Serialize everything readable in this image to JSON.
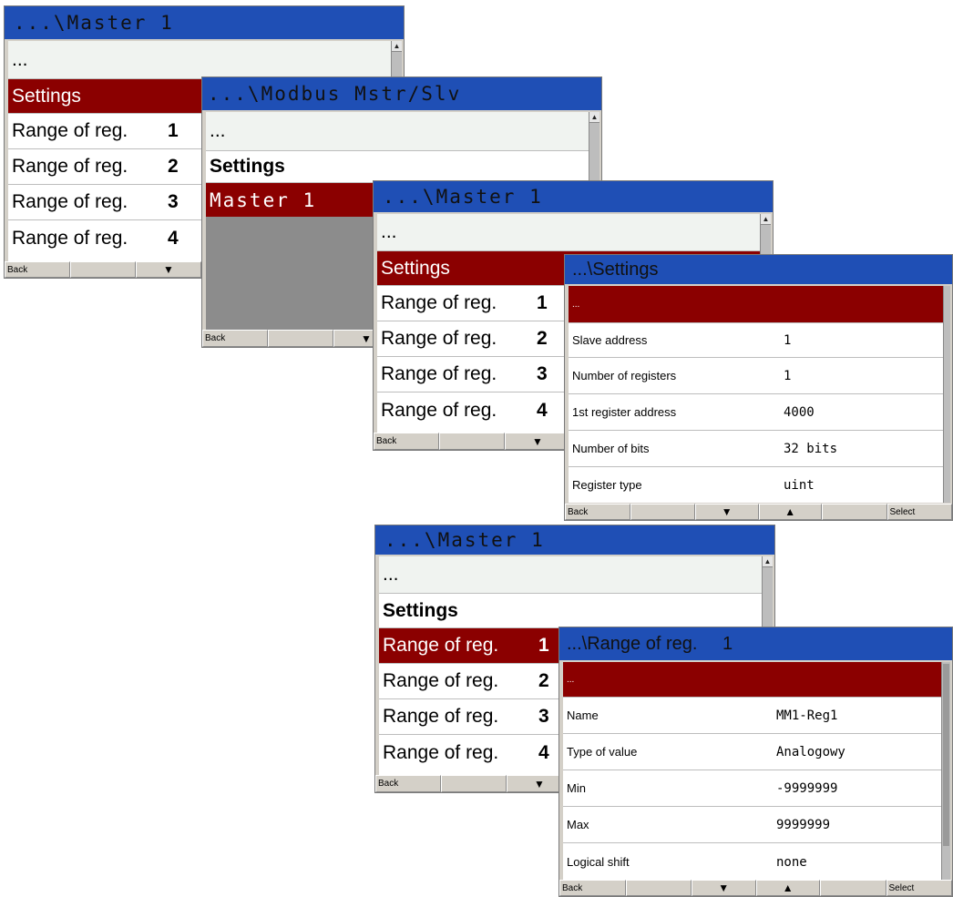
{
  "colors": {
    "title_bar": "#1f4fb5",
    "selected_row": "#8b0000",
    "footer": "#d4d0c8"
  },
  "screen1": {
    "title": "...\\Master  1",
    "rows": [
      {
        "label": "..."
      },
      {
        "label": "Settings"
      },
      {
        "label": "Range of reg.",
        "number": "1"
      },
      {
        "label": "Range of reg.",
        "number": "2"
      },
      {
        "label": "Range of reg.",
        "number": "3"
      },
      {
        "label": "Range of reg.",
        "number": "4"
      }
    ],
    "footer": [
      "Back",
      "",
      "▼"
    ]
  },
  "screen2": {
    "title": "...\\Modbus  Mstr/Slv",
    "rows": [
      {
        "label": "..."
      },
      {
        "label": "Settings"
      },
      {
        "label": "Master  1"
      }
    ],
    "footer": [
      "Back",
      "",
      "▼"
    ]
  },
  "screen3": {
    "title": "...\\Master  1",
    "rows": [
      {
        "label": "..."
      },
      {
        "label": "Settings"
      },
      {
        "label": "Range of reg.",
        "number": "1"
      },
      {
        "label": "Range of reg.",
        "number": "2"
      },
      {
        "label": "Range of reg.",
        "number": "3"
      },
      {
        "label": "Range of reg.",
        "number": "4"
      }
    ],
    "footer": [
      "Back",
      "",
      "▼"
    ]
  },
  "screen4": {
    "title": "...\\Settings",
    "rows": [
      {
        "label": "..."
      },
      {
        "label": "Slave address",
        "value": "1"
      },
      {
        "label": "Number of registers",
        "value": "1"
      },
      {
        "label": "1st register address",
        "value": "4000"
      },
      {
        "label": "Number of bits",
        "value": "32 bits"
      },
      {
        "label": "Register type",
        "value": "uint"
      }
    ],
    "footer": [
      "Back",
      "",
      "▼",
      "▲",
      "",
      "Select"
    ]
  },
  "screen5": {
    "title": "...\\Master  1",
    "rows": [
      {
        "label": "..."
      },
      {
        "label": "Settings"
      },
      {
        "label": "Range of reg.",
        "number": "1"
      },
      {
        "label": "Range of reg.",
        "number": "2"
      },
      {
        "label": "Range of reg.",
        "number": "3"
      },
      {
        "label": "Range of reg.",
        "number": "4"
      }
    ],
    "footer": [
      "Back",
      "",
      "▼"
    ]
  },
  "screen6": {
    "title": "...\\Range of reg.",
    "title_number": "1",
    "rows": [
      {
        "label": "..."
      },
      {
        "label": "Name",
        "value": "MM1-Reg1"
      },
      {
        "label": "Type of value",
        "value": "Analogowy"
      },
      {
        "label": "Min",
        "value": "-9999999"
      },
      {
        "label": "Max",
        "value": "9999999"
      },
      {
        "label": "Logical shift",
        "value": "none"
      }
    ],
    "footer": [
      "Back",
      "",
      "▼",
      "▲",
      "",
      "Select"
    ]
  }
}
